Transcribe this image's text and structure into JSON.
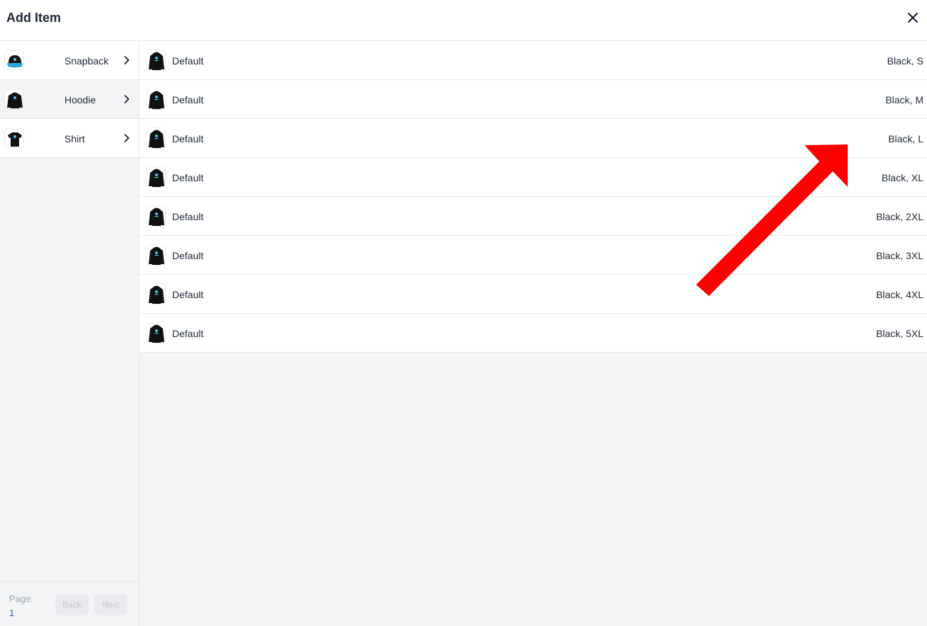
{
  "dialog": {
    "title": "Add Item",
    "close_icon": "close-icon"
  },
  "sidebar": {
    "categories": [
      {
        "label": "Snapback",
        "icon": "snapback-thumbnail"
      },
      {
        "label": "Hoodie",
        "icon": "hoodie-thumbnail",
        "selected": true
      },
      {
        "label": "Shirt",
        "icon": "shirt-thumbnail"
      }
    ]
  },
  "pagination": {
    "page_label": "Page:",
    "page_number": "1",
    "back_label": "Back",
    "next_label": "Next"
  },
  "variants": [
    {
      "name": "Default",
      "variant": "Black, S"
    },
    {
      "name": "Default",
      "variant": "Black, M"
    },
    {
      "name": "Default",
      "variant": "Black, L"
    },
    {
      "name": "Default",
      "variant": "Black, XL"
    },
    {
      "name": "Default",
      "variant": "Black, 2XL"
    },
    {
      "name": "Default",
      "variant": "Black, 3XL"
    },
    {
      "name": "Default",
      "variant": "Black, 4XL"
    },
    {
      "name": "Default",
      "variant": "Black, 5XL"
    }
  ],
  "annotation": {
    "type": "arrow",
    "color": "#ff0000"
  },
  "colors": {
    "accent": "#2563eb",
    "border": "#e5e7eb",
    "panel": "#f3f4f6"
  }
}
